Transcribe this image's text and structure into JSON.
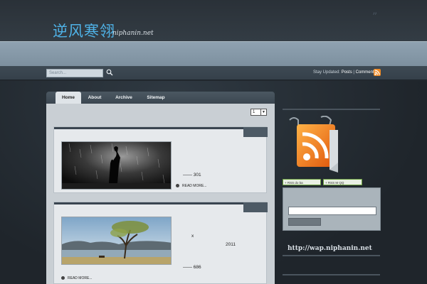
{
  "site": {
    "title": "逆风寒翎",
    "subtitle": "niphanin.net",
    "quote_mark": "”"
  },
  "nav": {
    "items": [
      "",
      "",
      "",
      "",
      ""
    ]
  },
  "search": {
    "placeholder": "Search...",
    "stay_label": "Stay Updated:",
    "posts_link": "Posts",
    "separator": "|",
    "comments_link": "Comments"
  },
  "tabs": [
    "Home",
    "About",
    "Archive",
    "Sitemap"
  ],
  "pager": {
    "selected": "1"
  },
  "posts": [
    {
      "title": "",
      "views": "—— 301",
      "readmore": "READ MORE...",
      "extra": []
    },
    {
      "title": "",
      "views": "—— 686",
      "readmore": "READ MORE...",
      "extra": [
        "x",
        "2011"
      ]
    }
  ],
  "sidebar": {
    "heading1": "",
    "heading2": "",
    "wap_url": "http://wap.niphanin.net",
    "heading3": "",
    "badge1": "+ RSS  do ba",
    "badge2": "+ RSS  M QQ"
  },
  "colors": {
    "brand": "#4fb3e8",
    "nav": "#8fa2b1",
    "rss": "#f08a24"
  }
}
